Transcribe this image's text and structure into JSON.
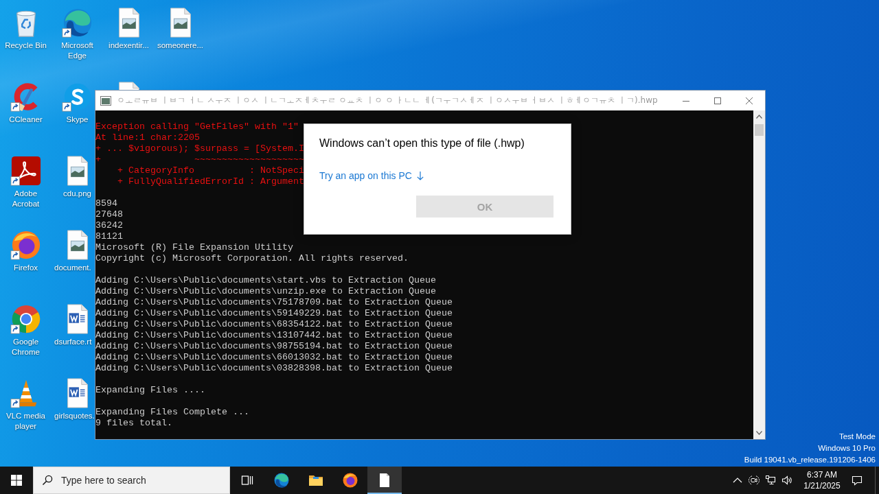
{
  "desktop": {
    "columns": [
      [
        {
          "kind": "recycle-bin",
          "label": "Recycle Bin",
          "shortcut": false
        },
        {
          "kind": "ccleaner",
          "label": "CCleaner",
          "shortcut": true
        },
        {
          "kind": "acrobat",
          "label": "Adobe Acrobat",
          "shortcut": true
        },
        {
          "kind": "firefox",
          "label": "Firefox",
          "shortcut": true
        },
        {
          "kind": "chrome",
          "label": "Google Chrome",
          "shortcut": true
        },
        {
          "kind": "vlc",
          "label": "VLC media player",
          "shortcut": true
        }
      ],
      [
        {
          "kind": "edge",
          "label": "Microsoft Edge",
          "shortcut": true
        },
        {
          "kind": "skype",
          "label": "Skype",
          "shortcut": true
        },
        {
          "kind": "image-file",
          "label": "cdu.png",
          "shortcut": false
        },
        {
          "kind": "image-file",
          "label": "document.",
          "shortcut": false,
          "covered": true
        },
        {
          "kind": "word-file",
          "label": "dsurface.rt",
          "shortcut": false,
          "covered": true
        },
        {
          "kind": "word-file",
          "label": "girlsquotes.",
          "shortcut": false,
          "covered": true
        }
      ],
      [
        {
          "kind": "image-file",
          "label": "indexentir...",
          "shortcut": false
        },
        {
          "kind": "word-file",
          "shortcut": false,
          "covered": true
        }
      ],
      [
        {
          "kind": "image-file",
          "label": "someonere...",
          "shortcut": false
        }
      ]
    ]
  },
  "console": {
    "title": "ㅇㅗㄹㅠㅂ ㅣㅂㄱ ㅓㄴ ㅅㅜㅈ ㅣㅇㅅ ㅣㄴㄱㅗㅈㅔㅊㅜㄹ ㅇㅛㅊ ㅣㅇ ㅇ ㅏㄴㄴ ㅔ(ㄱㅜㄱㅅㅔㅈ ㅣㅇㅅㅜㅂ ㅓㅂㅅ ㅣㅎㅔㅇㄱㅠㅊ ㅣㄱ).hwp",
    "blocks": [
      {
        "kind": "error",
        "lines": [
          "Exception calling \"GetFiles\" with \"1\"",
          "At line:1 char:2205",
          "+ ... $vigorous); $surpass = [System.I",
          "+                 ~~~~~~~~~~~~~~~~~~~~",
          "    + CategoryInfo          : NotSpeci",
          "    + FullyQualifiedErrorId : Argument"
        ]
      },
      {
        "kind": "output",
        "lines": [
          "8594",
          "27648",
          "36242",
          "81121",
          "Microsoft (R) File Expansion Utility",
          "Copyright (c) Microsoft Corporation. All rights reserved."
        ]
      },
      {
        "kind": "output",
        "lines": [
          "Adding C:\\Users\\Public\\documents\\start.vbs to Extraction Queue",
          "Adding C:\\Users\\Public\\documents\\unzip.exe to Extraction Queue",
          "Adding C:\\Users\\Public\\documents\\75178709.bat to Extraction Queue",
          "Adding C:\\Users\\Public\\documents\\59149229.bat to Extraction Queue",
          "Adding C:\\Users\\Public\\documents\\68354122.bat to Extraction Queue",
          "Adding C:\\Users\\Public\\documents\\13107442.bat to Extraction Queue",
          "Adding C:\\Users\\Public\\documents\\98755194.bat to Extraction Queue",
          "Adding C:\\Users\\Public\\documents\\66013032.bat to Extraction Queue",
          "Adding C:\\Users\\Public\\documents\\03828398.bat to Extraction Queue"
        ]
      },
      {
        "kind": "output",
        "lines": [
          "Expanding Files ...."
        ]
      },
      {
        "kind": "output",
        "lines": [
          "Expanding Files Complete ...",
          "9 files total."
        ]
      }
    ]
  },
  "dialog": {
    "title": "Windows can’t open this type of file (.hwp)",
    "link": "Try an app on this PC",
    "ok_button": {
      "label": "OK",
      "disabled": true
    }
  },
  "edition_info": [
    "Test Mode",
    "Windows 10 Pro",
    "Build 19041.vb_release.191206-1406"
  ],
  "taskbar": {
    "search": {
      "placeholder": "Type here to search"
    },
    "apps": [
      {
        "kind": "task-view",
        "active": false
      },
      {
        "kind": "edge",
        "active": false
      },
      {
        "kind": "file-explorer",
        "active": false
      },
      {
        "kind": "firefox",
        "active": false
      },
      {
        "kind": "document",
        "active": true
      }
    ],
    "clock": {
      "time": "6:37 AM",
      "date": "1/21/2025"
    }
  }
}
